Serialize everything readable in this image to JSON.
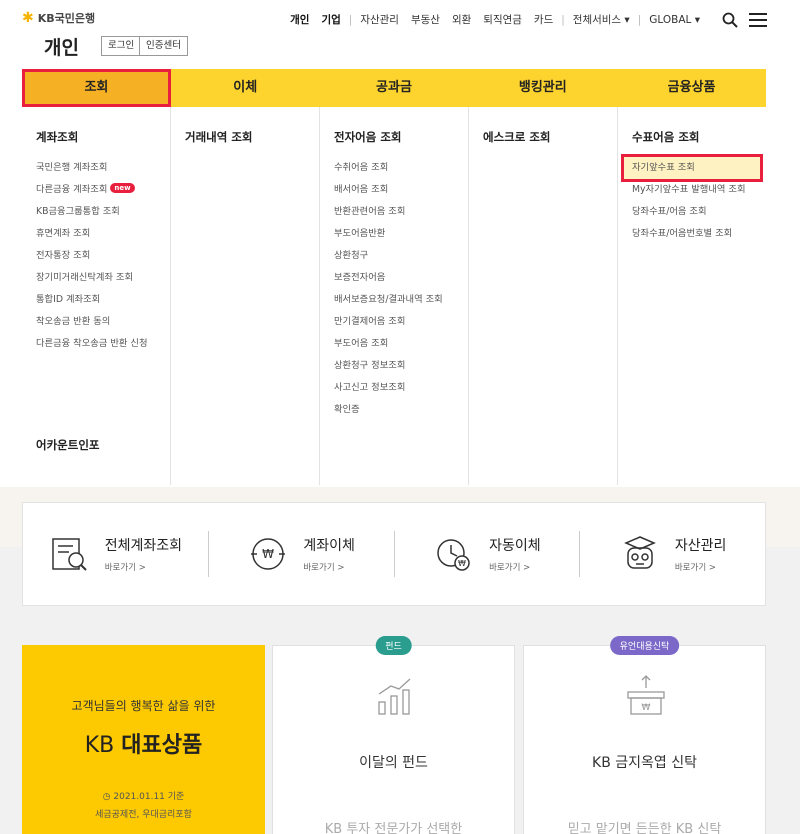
{
  "header": {
    "logo_text": "KB국민은행",
    "site_title": "개인",
    "login_label": "로그인",
    "cert_label": "인증센터",
    "topnav": [
      "개인",
      "기업",
      "자산관리",
      "부동산",
      "외환",
      "퇴직연금",
      "카드",
      "전체서비스 ▾",
      "GLOBAL ▾"
    ]
  },
  "mainnav": {
    "tabs": [
      "조회",
      "이체",
      "공과금",
      "뱅킹관리",
      "금융상품"
    ]
  },
  "mega": {
    "col1": {
      "title": "계좌조회",
      "items": [
        "국민은행 계좌조회",
        "다른금융 계좌조회",
        "KB금융그룹통합 조회",
        "휴면계좌 조회",
        "전자통장 조회",
        "장기미거래신탁계좌 조회",
        "통합ID 계좌조회",
        "착오송금 반환 동의",
        "다른금융 착오송금 반환 신청"
      ],
      "new_badge": "new",
      "bottom_title": "어카운트인포"
    },
    "col2": {
      "title": "거래내역 조회"
    },
    "col3": {
      "title": "전자어음 조회",
      "items": [
        "수취어음 조회",
        "배서어음 조회",
        "반환관련어음 조회",
        "부도어음반환",
        "상환청구",
        "보증전자어음",
        "배서보증요청/결과내역 조회",
        "만기결제어음 조회",
        "부도어음 조회",
        "상환청구 정보조회",
        "사고신고 정보조회",
        "확인증"
      ]
    },
    "col4": {
      "title": "에스크로 조회"
    },
    "col5": {
      "title": "수표어음 조회",
      "items": [
        "자기앞수표 조회",
        "My자기앞수표 발행내역 조회",
        "당좌수표/어음 조회",
        "당좌수표/어음번호별 조회"
      ]
    }
  },
  "quick": [
    {
      "title": "전체계좌조회",
      "link": "바로가기 >",
      "icon": "account-search-icon"
    },
    {
      "title": "계좌이체",
      "link": "바로가기 >",
      "icon": "transfer-icon"
    },
    {
      "title": "자동이체",
      "link": "바로가기 >",
      "icon": "auto-transfer-icon"
    },
    {
      "title": "자산관리",
      "link": "바로가기 >",
      "icon": "asset-robot-icon"
    }
  ],
  "cards": {
    "yellow": {
      "line1": "고객님들의 행복한 삶을 위한",
      "line2a": "KB ",
      "line2b": "대표상품",
      "date": "2021.01.11 기준",
      "note": "세금공제전, 우대금리포함"
    },
    "fund": {
      "badge": "펀드",
      "title": "이달의 펀드",
      "sub": "KB 투자 전문가가 선택한"
    },
    "trust": {
      "badge": "유언대용신탁",
      "title": "KB 금지옥엽 신탁",
      "sub": "믿고 맡기면 든든한 KB 신탁"
    }
  },
  "colors": {
    "brand_yellow": "#fdd32e",
    "active_tab": "#f5b023",
    "highlight_red": "#e8203d"
  }
}
